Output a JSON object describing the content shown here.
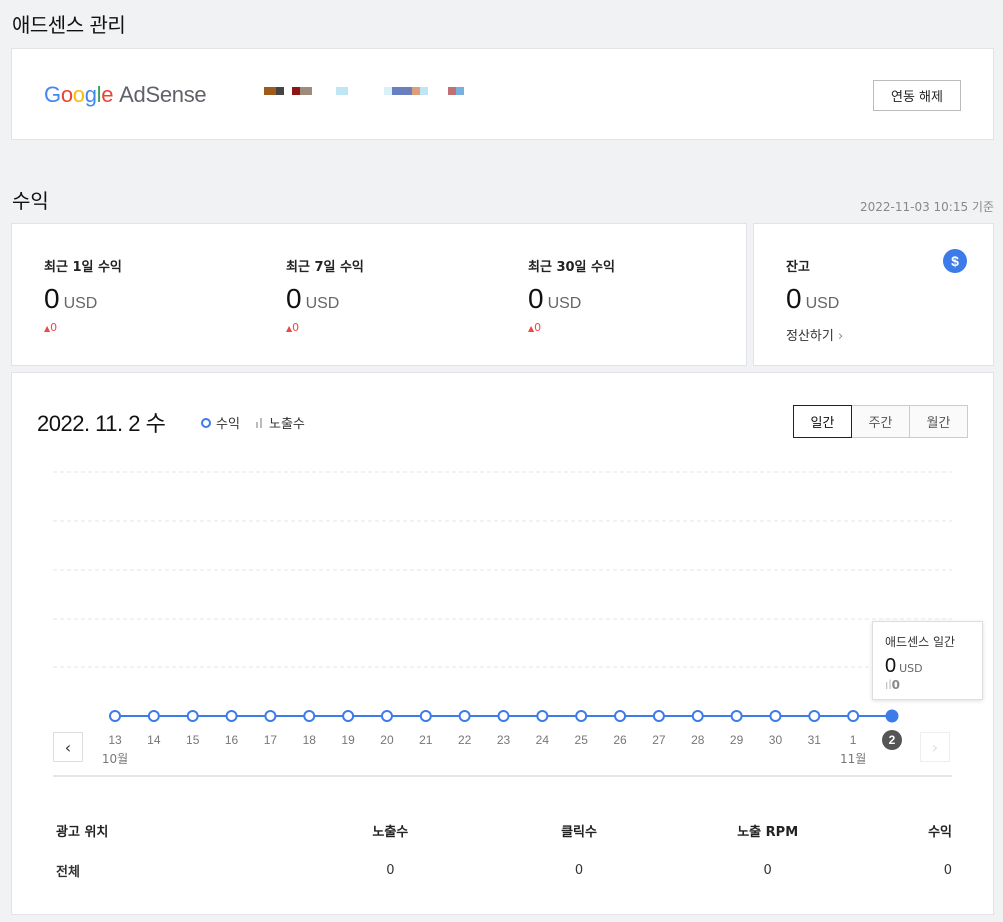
{
  "header": {
    "title": "애드센스 관리"
  },
  "adsense": {
    "logo_google": [
      "G",
      "o",
      "o",
      "g",
      "l",
      "e"
    ],
    "logo_product": "AdSense",
    "unlink_label": "연동 해제"
  },
  "revenue": {
    "title": "수익",
    "timestamp": "2022-11-03 10:15 기준",
    "stats": [
      {
        "label": "최근 1일 수익",
        "value": "0",
        "unit": "USD",
        "delta": "0"
      },
      {
        "label": "최근 7일 수익",
        "value": "0",
        "unit": "USD",
        "delta": "0"
      },
      {
        "label": "최근 30일 수익",
        "value": "0",
        "unit": "USD",
        "delta": "0"
      }
    ],
    "balance": {
      "label": "잔고",
      "value": "0",
      "unit": "USD",
      "settle_label": "정산하기",
      "icon": "dollar-icon"
    }
  },
  "chart": {
    "date_label": "2022. 11. 2 수",
    "legend": {
      "earnings": "수익",
      "impressions": "노출수"
    },
    "tabs": [
      {
        "label": "일간",
        "active": true
      },
      {
        "label": "주간",
        "active": false
      },
      {
        "label": "월간",
        "active": false
      }
    ],
    "tooltip": {
      "title": "애드센스 일간",
      "value": "0",
      "unit": "USD",
      "impressions": "0"
    },
    "month_labels": {
      "start": "10월",
      "end": "11월"
    },
    "accent": "#3d7be9"
  },
  "chart_data": {
    "type": "line",
    "x": [
      "13",
      "14",
      "15",
      "16",
      "17",
      "18",
      "19",
      "20",
      "21",
      "22",
      "23",
      "24",
      "25",
      "26",
      "27",
      "28",
      "29",
      "30",
      "31",
      "1",
      "2"
    ],
    "series": [
      {
        "name": "수익",
        "values": [
          0,
          0,
          0,
          0,
          0,
          0,
          0,
          0,
          0,
          0,
          0,
          0,
          0,
          0,
          0,
          0,
          0,
          0,
          0,
          0,
          0
        ]
      }
    ],
    "selected_index": 20
  },
  "table": {
    "headers": [
      "광고 위치",
      "노출수",
      "클릭수",
      "노출 RPM",
      "수익"
    ],
    "rows": [
      [
        "전체",
        "0",
        "0",
        "0",
        "0"
      ]
    ]
  }
}
